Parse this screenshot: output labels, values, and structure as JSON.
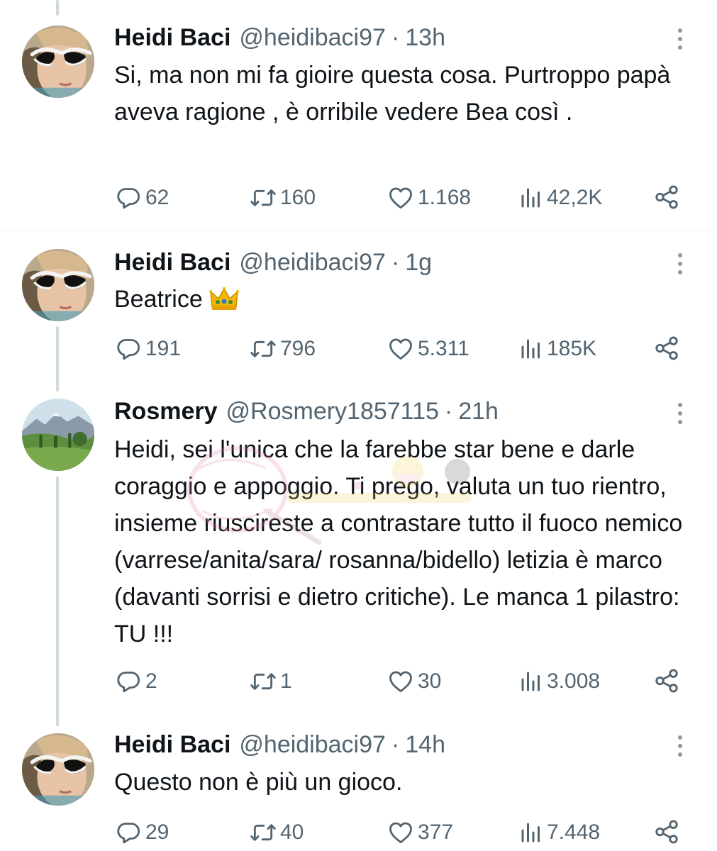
{
  "tweets": [
    {
      "name": "Heidi Baci",
      "handle": "@heidibaci97",
      "separator": "·",
      "time": "13h",
      "text": "Si, ma non mi fa gioire questa cosa. Purtroppo papà aveva ragione , è orribile vedere Bea così .",
      "avatar": "avatar-heidi",
      "replies": "62",
      "retweets": "160",
      "likes": "1.168",
      "views": "42,2K"
    },
    {
      "name": "Heidi Baci",
      "handle": "@heidibaci97",
      "separator": "·",
      "time": "1g",
      "text": "Beatrice",
      "emoji": "crown",
      "avatar": "avatar-heidi",
      "replies": "191",
      "retweets": "796",
      "likes": "5.311",
      "views": "185K"
    },
    {
      "name": "Rosmery",
      "handle": "@Rosmery1857115",
      "separator": "·",
      "time": "21h",
      "text": "Heidi, sei l'unica che la farebbe star bene e darle coraggio e appoggio. Ti prego, valuta un tuo rientro, insieme riuscireste a contrastare tutto il fuoco nemico (varrese/anita/sara/ rosanna/bidello) letizia è marco (davanti sorrisi e dietro critiche). Le manca 1 pilastro: TU !!!",
      "avatar": "avatar-landscape",
      "replies": "2",
      "retweets": "1",
      "likes": "30",
      "views": "3.008"
    },
    {
      "name": "Heidi Baci",
      "handle": "@heidibaci97",
      "separator": "·",
      "time": "14h",
      "text": "Questo non è più un gioco.",
      "avatar": "avatar-heidi",
      "replies": "29",
      "retweets": "40",
      "likes": "377",
      "views": "7.448"
    }
  ],
  "watermark": "watermark-logo",
  "colors": {
    "text_primary": "#0f1419",
    "text_secondary": "#536471",
    "thread_line": "#cfd9de",
    "divider": "#eff3f4"
  },
  "icons": [
    "reply-icon",
    "retweet-icon",
    "like-icon",
    "views-icon",
    "share-icon",
    "more-icon",
    "crown-emoji"
  ]
}
